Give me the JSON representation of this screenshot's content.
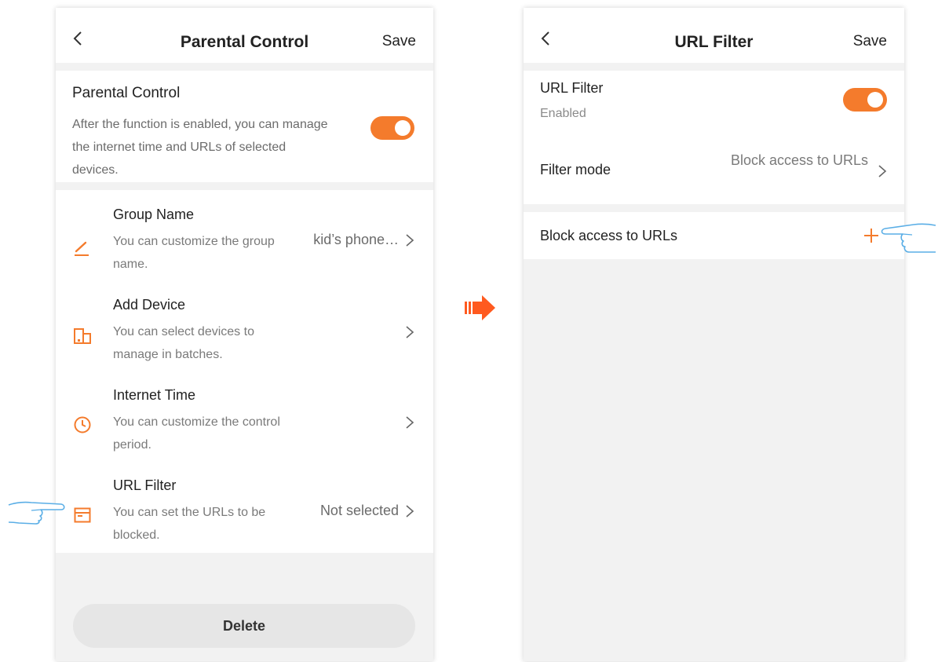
{
  "parental_control_screen": {
    "nav": {
      "title": "Parental Control",
      "save_label": "Save",
      "back_icon": "chevron-left-icon"
    },
    "feature": {
      "title": "Parental Control",
      "description": "After the function is enabled, you can manage the internet time and URLs of selected devices.",
      "toggle_on": true
    },
    "items": [
      {
        "name": "Group Name",
        "description": "You can customize the group name.",
        "value": "kid’s phone…",
        "icon": "pencil-icon"
      },
      {
        "name": "Add Device",
        "description": "You can select devices to manage in batches.",
        "value": "",
        "icon": "device-icon"
      },
      {
        "name": "Internet Time",
        "description": "You can customize the control period.",
        "value": "",
        "icon": "clock-icon"
      },
      {
        "name": "URL Filter",
        "description": "You can set the URLs to be blocked.",
        "value": "Not selected",
        "icon": "browser-window-icon"
      }
    ],
    "delete_label": "Delete"
  },
  "url_filter_screen": {
    "nav": {
      "title": "URL Filter",
      "save_label": "Save",
      "back_icon": "chevron-left-icon"
    },
    "feature": {
      "title": "URL Filter",
      "status": "Enabled",
      "toggle_on": true
    },
    "filter_mode": {
      "label": "Filter mode",
      "value": "Block access to URLs"
    },
    "block_list": {
      "label": "Block access to URLs",
      "add_icon": "plus-icon"
    }
  },
  "colors": {
    "accent": "#f47b2c",
    "background": "#f2f2f2",
    "card": "#ffffff",
    "hand_outline": "#5aaee6"
  }
}
